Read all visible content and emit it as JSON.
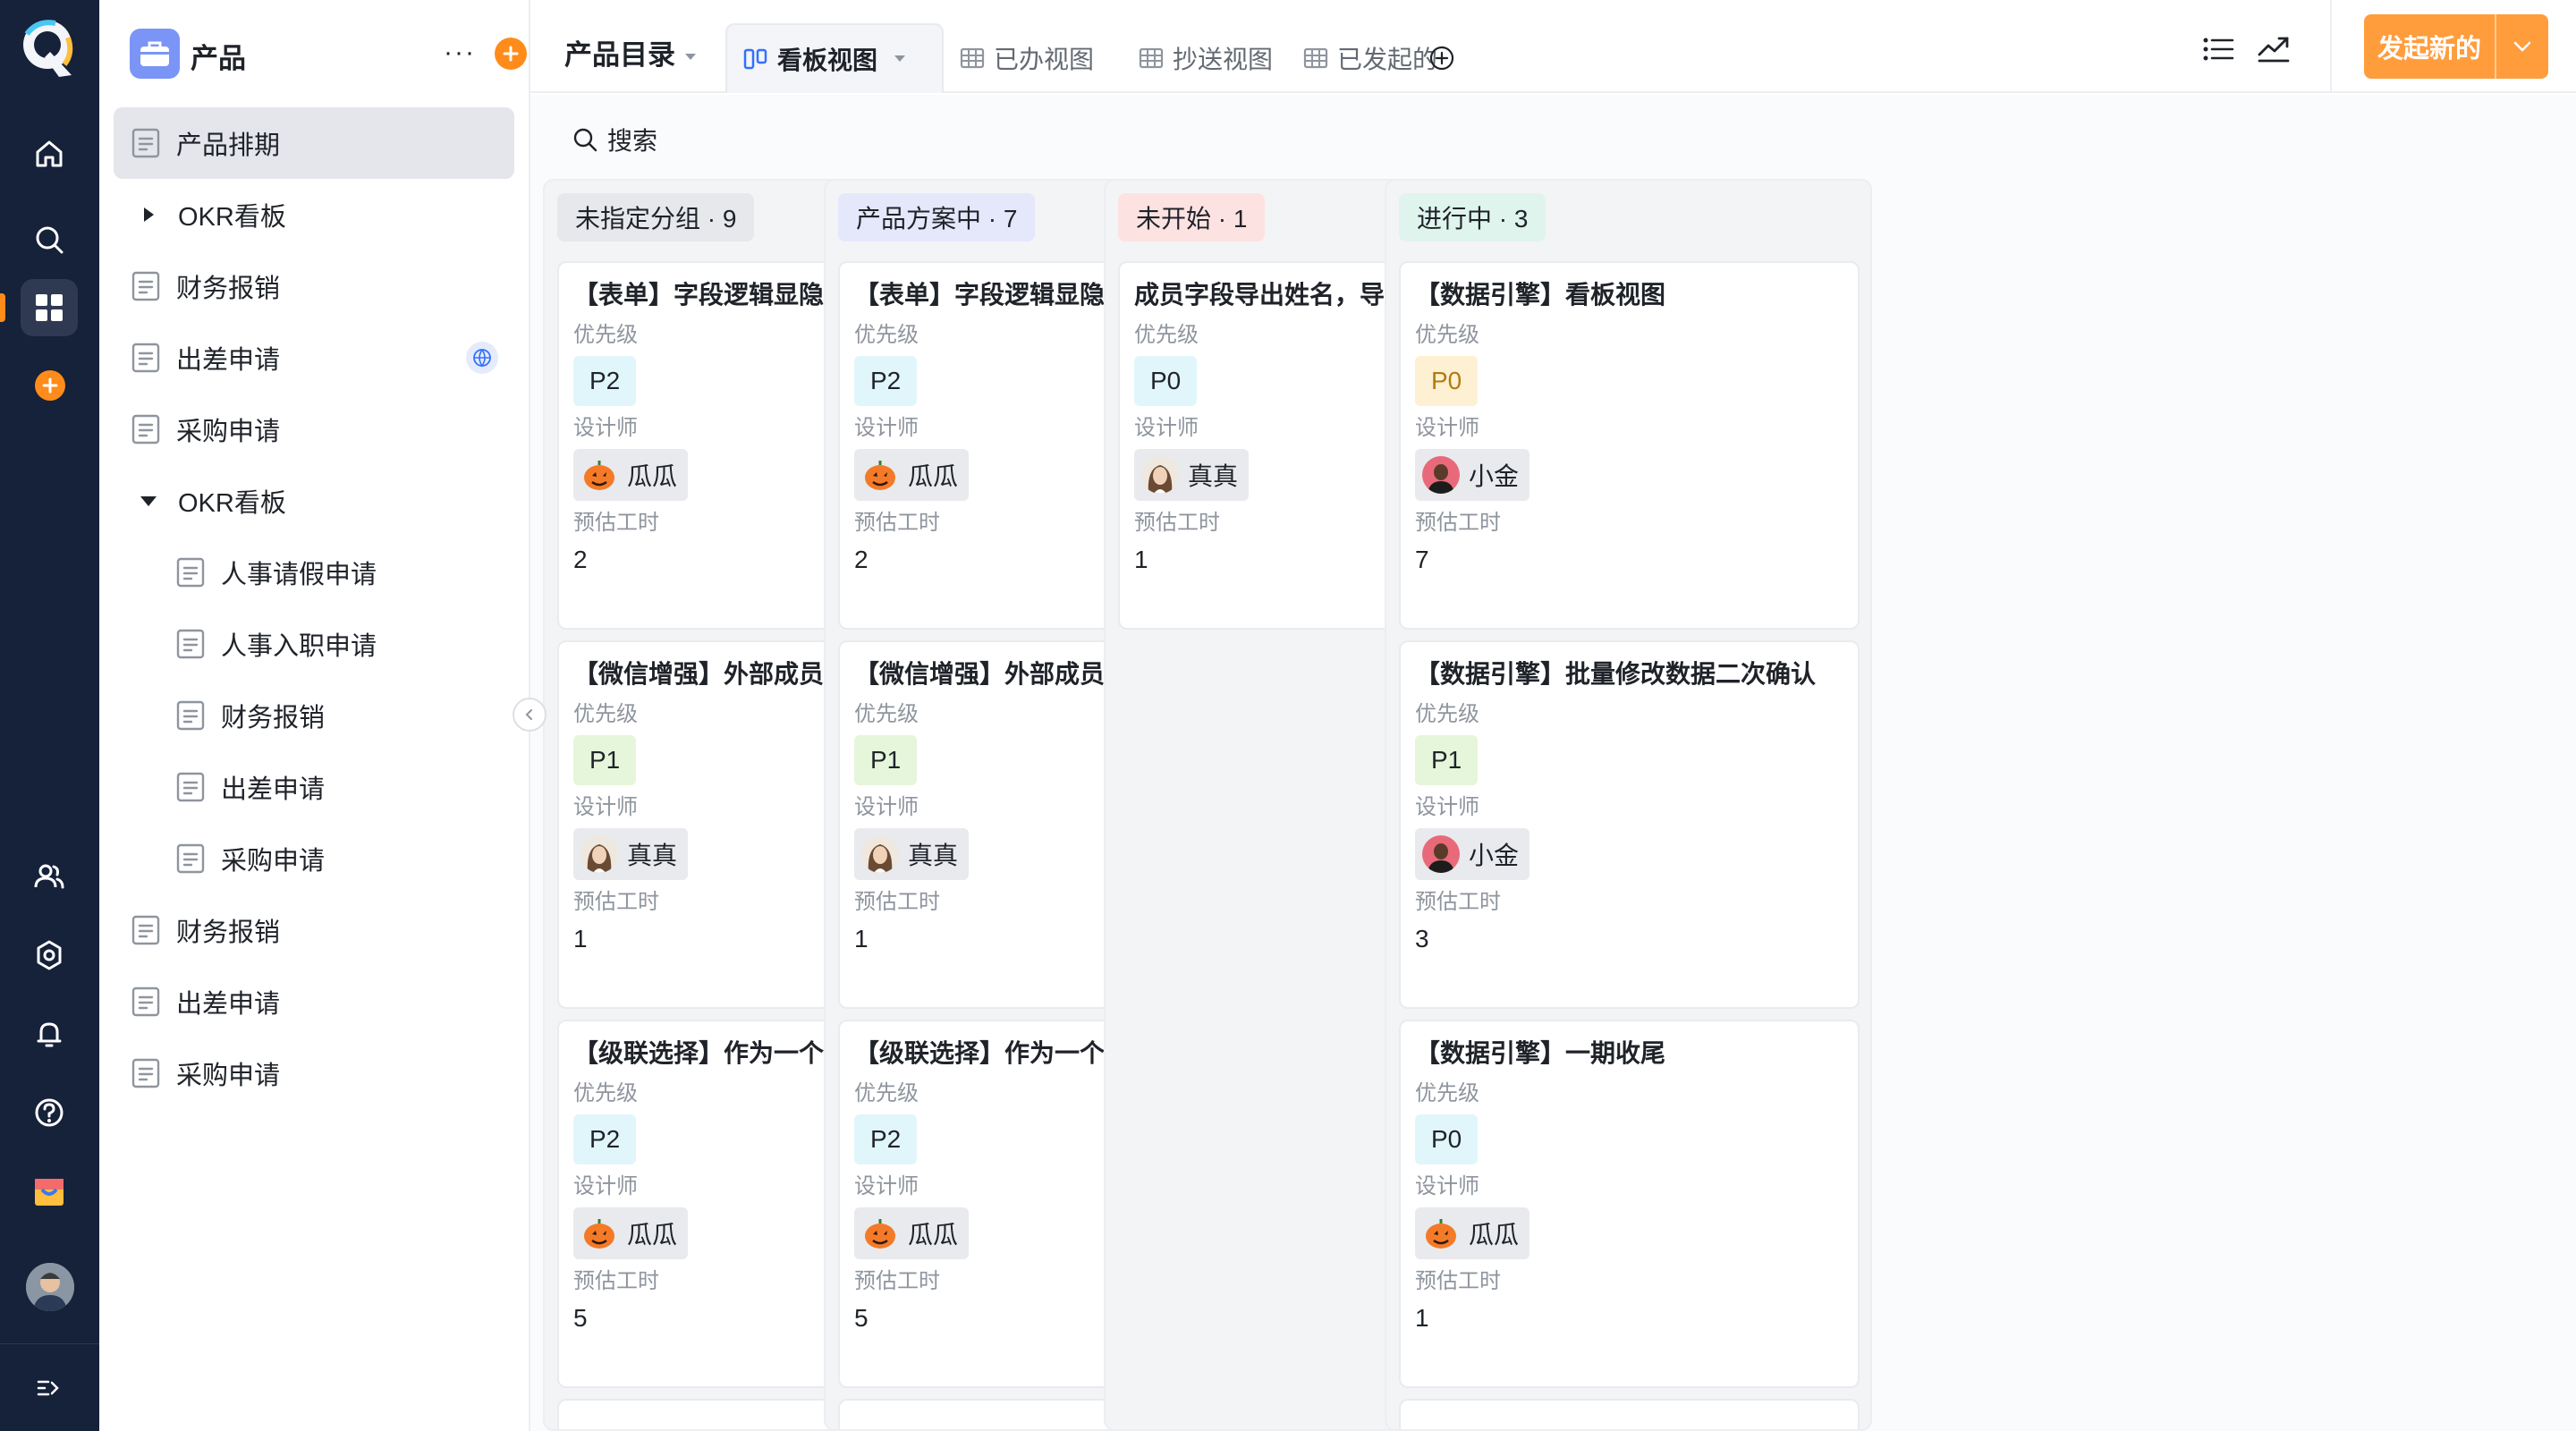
{
  "app": {
    "brand_colors": {
      "rail": "#16213a",
      "accent": "#ff8c1a",
      "launch": "#ff9d3d"
    }
  },
  "rail": {
    "icons": [
      "home-icon",
      "search-icon",
      "apps-icon",
      "add-icon",
      "contacts-icon",
      "settings-icon",
      "bell-icon",
      "help-icon",
      "gift-icon",
      "avatar",
      "expand-icon"
    ]
  },
  "sidebar": {
    "title": "产品",
    "items": [
      {
        "label": "产品排期",
        "type": "doc",
        "active": true
      },
      {
        "label": "OKR看板",
        "type": "folder",
        "expanded": false
      },
      {
        "label": "财务报销",
        "type": "doc"
      },
      {
        "label": "出差申请",
        "type": "doc",
        "globe": true
      },
      {
        "label": "采购申请",
        "type": "doc"
      },
      {
        "label": "OKR看板",
        "type": "folder",
        "expanded": true
      },
      {
        "label": "人事请假申请",
        "type": "doc",
        "child": true
      },
      {
        "label": "人事入职申请",
        "type": "doc",
        "child": true
      },
      {
        "label": "财务报销",
        "type": "doc",
        "child": true
      },
      {
        "label": "出差申请",
        "type": "doc",
        "child": true
      },
      {
        "label": "采购申请",
        "type": "doc",
        "child": true
      },
      {
        "label": "财务报销",
        "type": "doc"
      },
      {
        "label": "出差申请",
        "type": "doc"
      },
      {
        "label": "采购申请",
        "type": "doc"
      }
    ]
  },
  "topbar": {
    "directory": "产品目录",
    "tabs": [
      {
        "label": "看板视图",
        "active": true
      },
      {
        "label": "已办视图"
      },
      {
        "label": "抄送视图"
      },
      {
        "label": "已发起的"
      }
    ],
    "launch_label": "发起新的"
  },
  "board": {
    "search_label": "搜索",
    "field_labels": {
      "priority": "优先级",
      "designer": "设计师",
      "hours": "预估工时"
    },
    "columns": [
      {
        "title": "未指定分组 · 9",
        "color": "#e6e8ec",
        "text_color": "#1f2329",
        "cards": [
          {
            "title": "【表单】字段逻辑显隐",
            "priority": "P2",
            "designer": "瓜瓜",
            "hours": "2"
          },
          {
            "title": "【微信增强】外部成员支持动态负责人",
            "priority": "P1",
            "designer": "真真",
            "hours": "1"
          },
          {
            "title": "【级联选择】作为一个字段",
            "priority": "P2",
            "designer": "瓜瓜",
            "hours": "5"
          }
        ]
      },
      {
        "title": "产品方案中 · 7",
        "color": "#e5e7fb",
        "text_color": "#1f2329",
        "cards": [
          {
            "title": "【表单】字段逻辑显隐",
            "priority": "P2",
            "designer": "瓜瓜",
            "hours": "2"
          },
          {
            "title": "【微信增强】外部成员支持动态负责人",
            "priority": "P1",
            "designer": "真真",
            "hours": "1"
          },
          {
            "title": "【级联选择】作为一个字段",
            "priority": "P2",
            "designer": "瓜瓜",
            "hours": "5"
          }
        ]
      },
      {
        "title": "未开始 · 1",
        "color": "#fde2e2",
        "text_color": "#1f2329",
        "cards": [
          {
            "title": "成员字段导出姓名，导入是邮箱",
            "priority": "P0",
            "designer": "真真",
            "hours": "1"
          }
        ]
      },
      {
        "title": "进行中 · 3",
        "color": "#dff4ec",
        "text_color": "#1f2329",
        "cards": [
          {
            "title": "【数据引擎】看板视图",
            "priority": "P0",
            "priority_style": "orange",
            "designer": "小金",
            "hours": "7"
          },
          {
            "title": "【数据引擎】批量修改数据二次确认",
            "priority": "P1",
            "designer": "小金",
            "hours": "3"
          },
          {
            "title": "【数据引擎】一期收尾",
            "priority": "P0",
            "designer": "瓜瓜",
            "hours": "1"
          }
        ]
      }
    ]
  }
}
